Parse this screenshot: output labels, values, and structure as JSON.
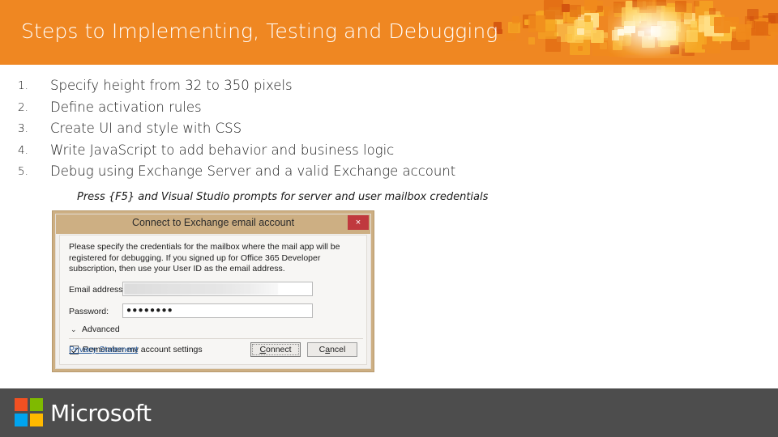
{
  "slide": {
    "title": "Steps to Implementing, Testing and Debugging",
    "header_color": "#ef8722",
    "footer_color": "#4d4d4d"
  },
  "steps": [
    {
      "number": "1.",
      "text": "Specify height from 32 to 350 pixels"
    },
    {
      "number": "2.",
      "text": "Define activation rules"
    },
    {
      "number": "3.",
      "text": "Create UI and style with CSS"
    },
    {
      "number": "4.",
      "text": "Write JavaScript to add behavior and business logic"
    },
    {
      "number": "5.",
      "text": "Debug using Exchange Server and a valid Exchange account"
    }
  ],
  "note": "Press {F5} and Visual Studio prompts for server and user mailbox credentials",
  "dialog": {
    "title": "Connect to Exchange email account",
    "close_glyph": "×",
    "description": "Please specify the credentials for the mailbox where the mail app will be registered for debugging. If you signed up for Office 365 Developer subscription, then use your User ID as the email address.",
    "email_label": "Email address:",
    "email_value": "",
    "password_label": "Password:",
    "password_value": "●●●●●●●●",
    "advanced_label": "Advanced",
    "advanced_chevron": "⌄",
    "remember_label_accel": "R",
    "remember_label_rest": "emember my account settings",
    "privacy_link": "Privacy Statement",
    "connect_accel": "C",
    "connect_rest": "onnect",
    "cancel_accel_pre": "C",
    "cancel_accel": "a",
    "cancel_rest": "ncel",
    "frame_color": "#cdaf83",
    "close_color": "#c0393e"
  },
  "footer": {
    "brand": "Microsoft",
    "logo_colors": {
      "red": "#F25022",
      "green": "#7FBA00",
      "blue": "#00A4EF",
      "yellow": "#FFB900"
    }
  }
}
